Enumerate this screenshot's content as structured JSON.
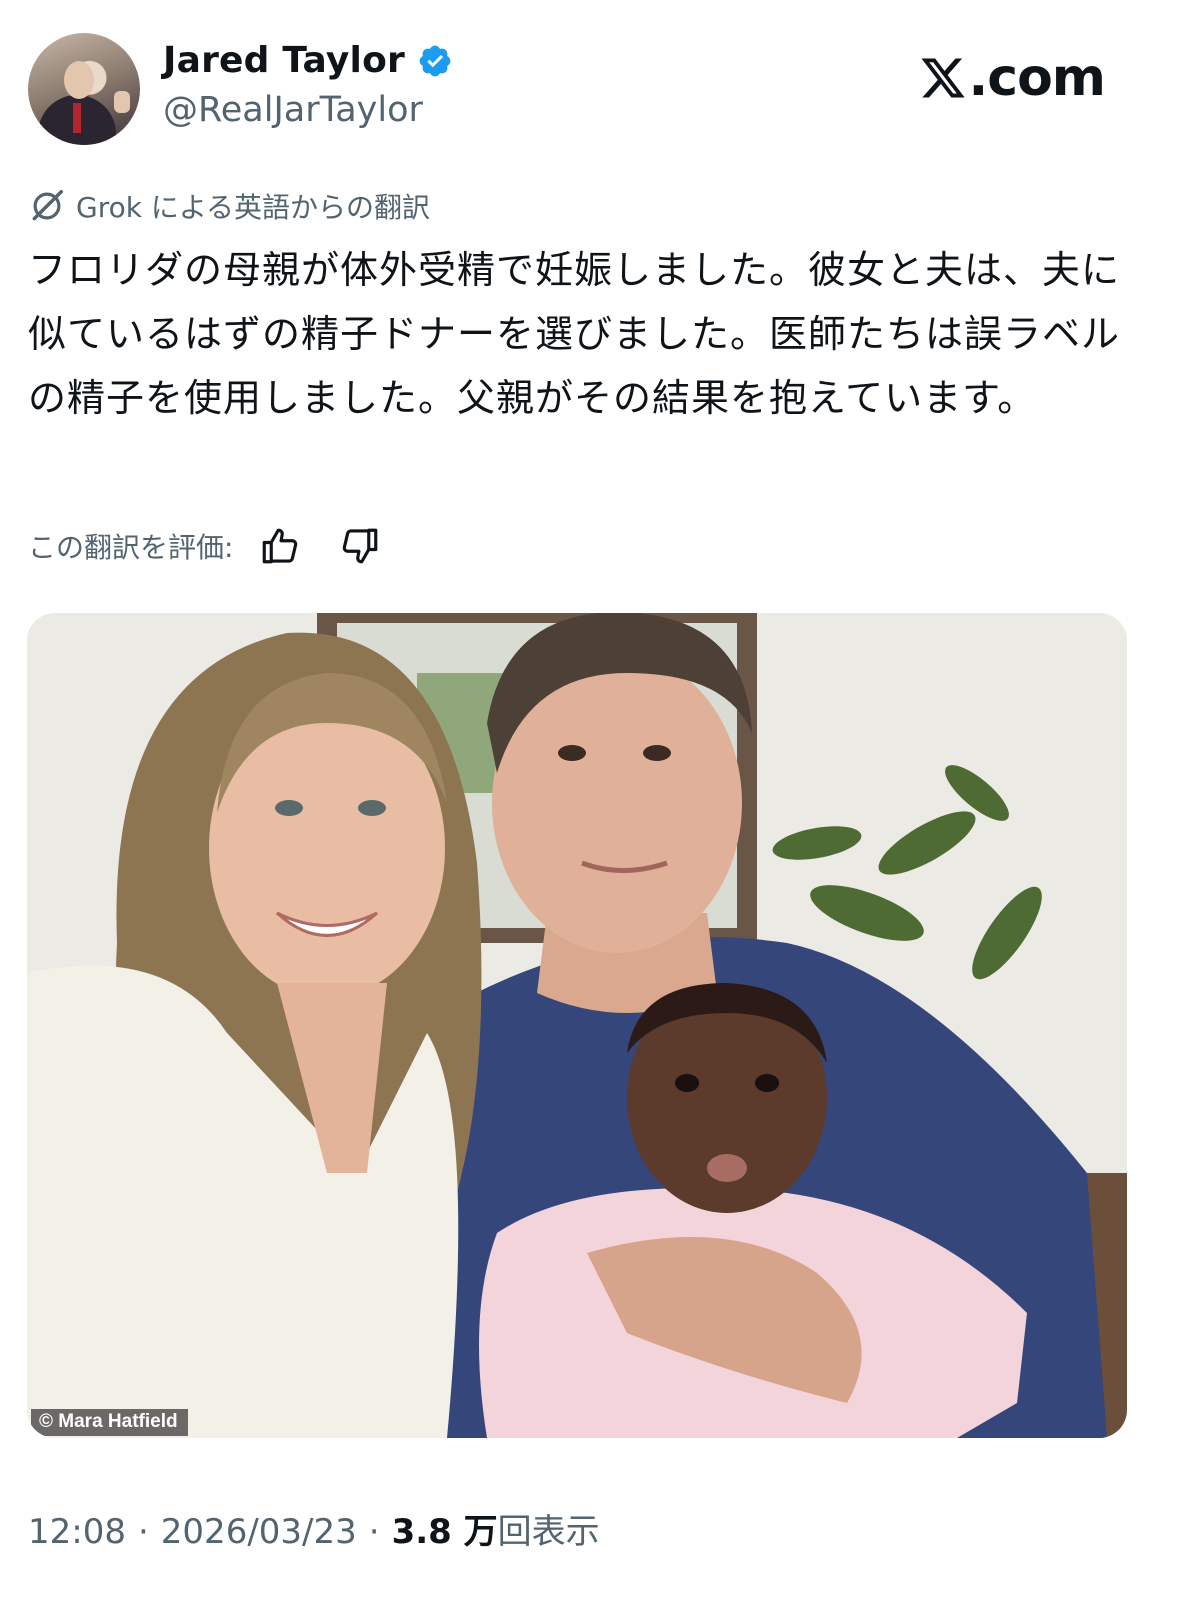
{
  "author": {
    "display_name": "Jared Taylor",
    "handle": "@RealJarTaylor",
    "verified": true,
    "avatar_icon": "speaker-photo-avatar"
  },
  "brand": {
    "logo_text": ".com"
  },
  "translation": {
    "label": "Grok による英語からの翻訳",
    "icon": "grok-icon"
  },
  "tweet": {
    "text": "フロリダの母親が体外受精で妊娠しました。彼女と夫は、夫に似ているはずの精子ドナーを選びました。医師たちは誤ラベルの精子を使用しました。父親がその結果を抱えています。"
  },
  "rating": {
    "label": "この翻訳を評価:",
    "up_icon": "thumbs-up-icon",
    "down_icon": "thumbs-down-icon"
  },
  "media": {
    "credit": "© Mara Hatfield"
  },
  "footer": {
    "time": "12:08",
    "separator": "·",
    "date": "2026/03/23",
    "views_count": "3.8 万",
    "views_label": "回表示"
  },
  "colors": {
    "text": "#0f1419",
    "secondary": "#536471",
    "verified": "#1d9bf0"
  }
}
